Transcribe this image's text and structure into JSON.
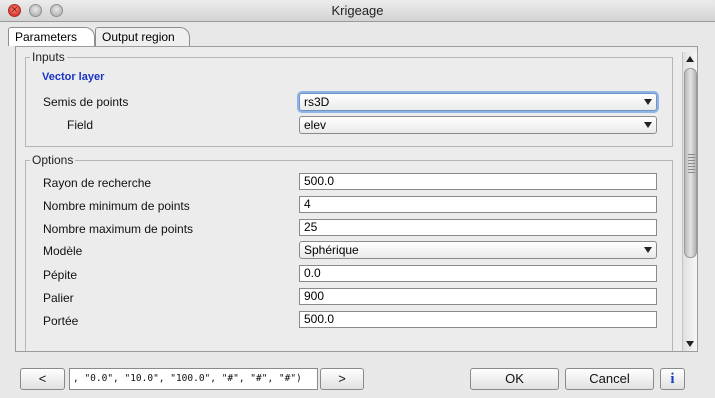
{
  "window": {
    "title": "Krigeage"
  },
  "tabs": [
    {
      "label": "Parameters",
      "active": true
    },
    {
      "label": "Output region",
      "active": false
    }
  ],
  "inputs": {
    "legend": "Inputs",
    "vector_layer_label": "Vector layer",
    "semis_label": "Semis de points",
    "semis_value": "rs3D",
    "field_label": "Field",
    "field_value": "elev"
  },
  "options": {
    "legend": "Options",
    "rows": [
      {
        "label": "Rayon de recherche",
        "value": "500.0",
        "kind": "text"
      },
      {
        "label": "Nombre minimum de points",
        "value": "4",
        "kind": "text"
      },
      {
        "label": "Nombre maximum de points",
        "value": "25",
        "kind": "text"
      },
      {
        "label": "Modèle",
        "value": "Sphérique",
        "kind": "combo"
      },
      {
        "label": "Pépite",
        "value": "0.0",
        "kind": "text"
      },
      {
        "label": "Palier",
        "value": "900",
        "kind": "text"
      },
      {
        "label": "Portée",
        "value": "500.0",
        "kind": "text"
      }
    ]
  },
  "footer": {
    "prev_label": "<",
    "next_label": ">",
    "command_text": ", \"0.0\", \"10.0\", \"100.0\", \"#\", \"#\", \"#\")",
    "ok_label": "OK",
    "cancel_label": "Cancel",
    "info_label": "i"
  },
  "colors": {
    "accent_blue": "#1a32c9",
    "focus_ring": "#8fb4e3",
    "close_red": "#d8382d"
  }
}
